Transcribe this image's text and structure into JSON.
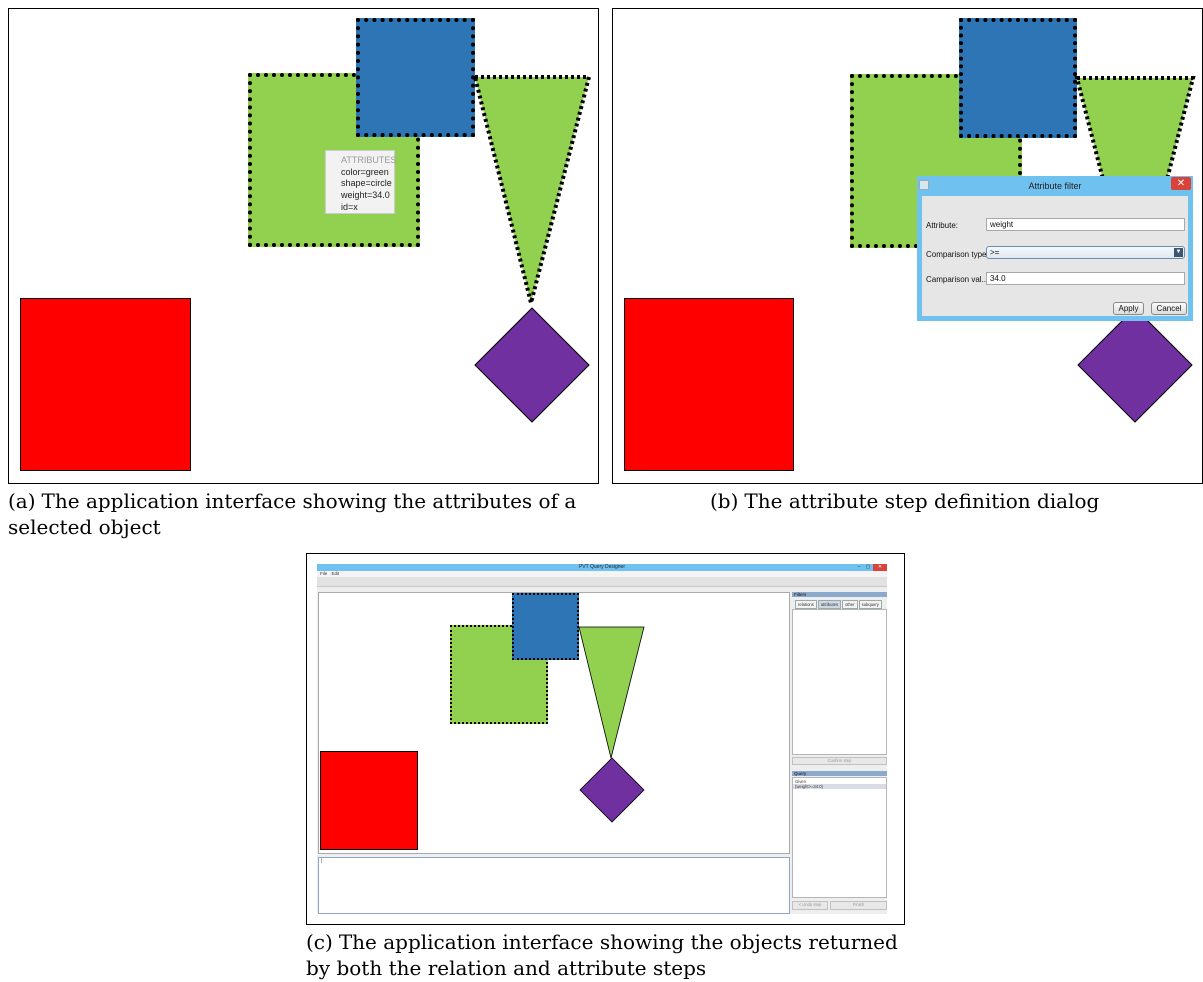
{
  "panel_a": {
    "tooltip": {
      "heading": "ATTRIBUTES",
      "lines": [
        "color=green",
        "shape=circle",
        "weight=34.0",
        "id=x"
      ]
    },
    "caption": {
      "label": "(a)",
      "text_line1": "The application interface showing the attributes of a",
      "text_line2": "selected object"
    }
  },
  "panel_b": {
    "dialog": {
      "title": "Attribute filter",
      "close_glyph": "✕",
      "attribute_label": "Attribute:",
      "attribute_value": "weight",
      "comparison_type_label": "Comparison type:",
      "comparison_type_value": ">=",
      "comparison_value_label": "Camparison val...",
      "comparison_value_value": "34.0",
      "apply_label": "Apply",
      "cancel_label": "Cancel"
    },
    "caption": {
      "label": "(b)",
      "text": "The attribute step definition dialog"
    }
  },
  "panel_c": {
    "window": {
      "title": "PVT Query Designer",
      "controls": [
        "–",
        "▢",
        "✕"
      ],
      "menu": [
        "File",
        "Edit"
      ],
      "console_prompt": "|",
      "filters_header": "Filters",
      "tabs": [
        "relations",
        "attributes",
        "other",
        "subquery"
      ],
      "active_tab": "attributes",
      "confirm_step_label": "Confirm step",
      "query_header": "Query",
      "query_rows": [
        "Given",
        "(weight>=34.0)"
      ],
      "undo_label": "< Undo step",
      "finish_label": "Finish"
    },
    "caption": {
      "label": "(c)",
      "text_line1": "The application interface showing the objects returned",
      "text_line2": "by both the relation and attribute steps"
    }
  },
  "colors": {
    "green": "#92d050",
    "blue": "#2e75b6",
    "red": "#ff0000",
    "purple": "#7030a0",
    "titlebar": "#6fc2f0"
  }
}
